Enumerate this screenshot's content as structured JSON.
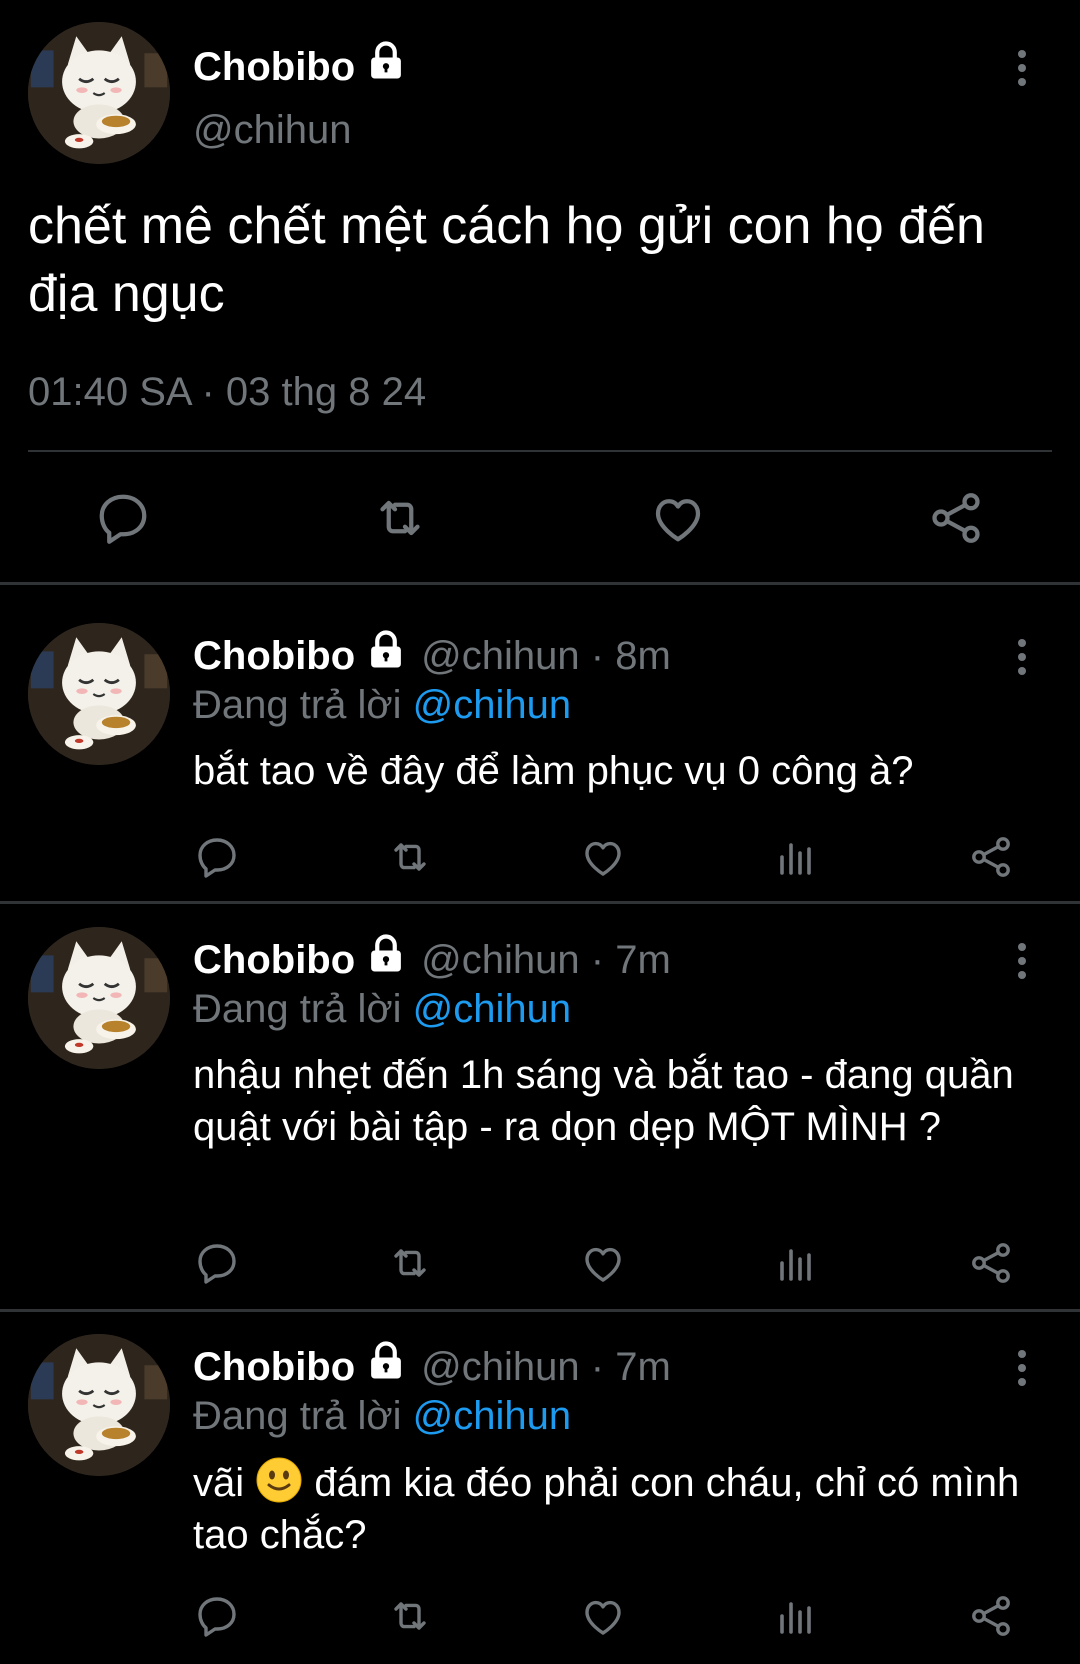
{
  "main_tweet": {
    "display_name": "Chobibo",
    "handle": "@chihun",
    "text": "chết mê chết mệt cách họ gửi con họ đến địa ngục",
    "timestamp": "01:40 SA · 03 thg 8 24",
    "actions": [
      "reply-icon",
      "retweet-icon",
      "like-icon",
      "share-icon"
    ]
  },
  "replies": [
    {
      "display_name": "Chobibo",
      "handle_time": "@chihun · 8m",
      "replying_prefix": "Đang trả lời",
      "replying_to": "@chihun",
      "text": "bắt tao về đây để làm phục vụ 0 công à?"
    },
    {
      "display_name": "Chobibo",
      "handle_time": "@chihun · 7m",
      "replying_prefix": "Đang trả lời",
      "replying_to": "@chihun",
      "text": "nhậu nhẹt đến 1h sáng và bắt tao - đang quần quật với bài tập - ra dọn dẹp MỘT MÌNH ?"
    },
    {
      "display_name": "Chobibo",
      "handle_time": "@chihun · 7m",
      "replying_prefix": "Đang trả lời",
      "replying_to": "@chihun",
      "text_before_emoji": "vãi",
      "emoji": "slightly-smiling-face",
      "text_after_emoji": "đám kia đéo phải con cháu, chỉ có mình tao chắc?"
    }
  ],
  "colors": {
    "background": "#000000",
    "text": "#ffffff",
    "secondary_text": "#71767b",
    "mention": "#1d9bf0",
    "divider": "#2f3336"
  }
}
